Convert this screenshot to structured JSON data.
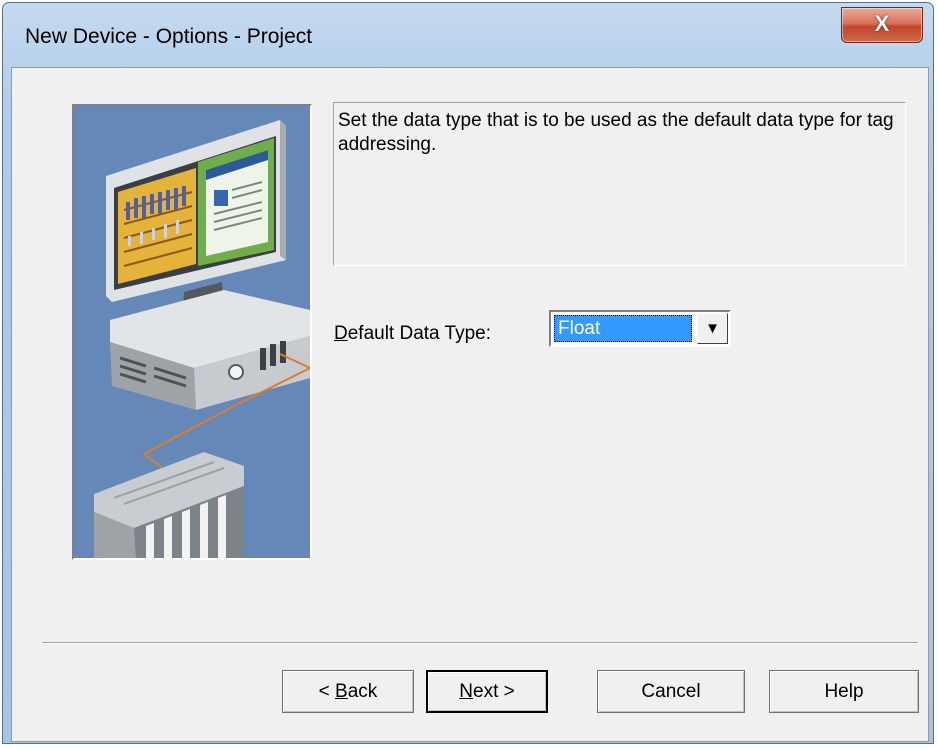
{
  "window": {
    "title": "New Device - Options - Project",
    "close_glyph": "X"
  },
  "description": "Set the data type that is to be used as the default data type for tag addressing.",
  "field": {
    "label_accel": "D",
    "label_rest": "efault Data Type:",
    "value": "Float",
    "arrow_glyph": "▼"
  },
  "buttons": {
    "back": {
      "prefix": "< ",
      "accel": "B",
      "rest": "ack"
    },
    "next": {
      "accel": "N",
      "rest": "ext >"
    },
    "cancel": "Cancel",
    "help": "Help"
  },
  "icons": [
    "close-icon",
    "dropdown-arrow-icon",
    "computer-plc-illustration"
  ],
  "colors": {
    "illustration_bg": "#6688b8",
    "selection": "#3399ff",
    "close_button": "#c4452c"
  }
}
